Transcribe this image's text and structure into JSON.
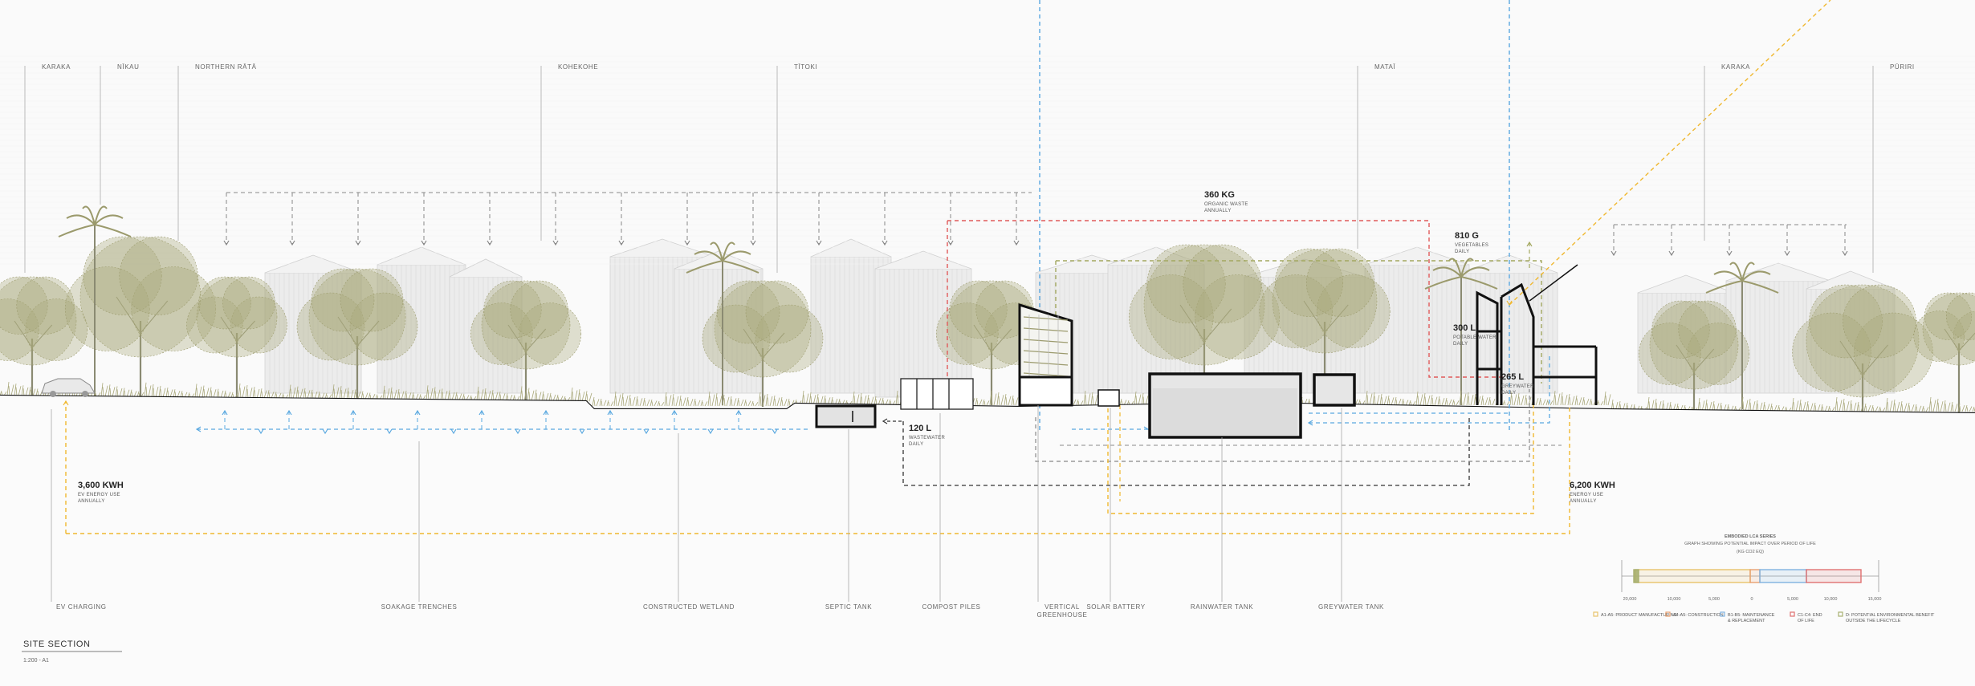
{
  "title": "SITE SECTION",
  "scale": "1:200 - A1",
  "species_labels": [
    "KARAKA",
    "NĪKAU",
    "NORTHERN RĀTĀ",
    "KOHEKOHE",
    "TĪTOKI",
    "MATAĪ",
    "KARAKA",
    "PŪRIRI"
  ],
  "component_labels": [
    "EV CHARGING",
    "SOAKAGE TRENCHES",
    "CONSTRUCTED WETLAND",
    "SEPTIC TANK",
    "COMPOST PILES",
    "VERTICAL GREENHOUSE",
    "SOLAR BATTERY",
    "RAINWATER TANK",
    "GREYWATER TANK"
  ],
  "quantities": [
    {
      "value": "360 KG",
      "sub1": "ORGANIC WASTE",
      "sub2": "ANNUALLY"
    },
    {
      "value": "810 G",
      "sub1": "VEGETABLES",
      "sub2": "DAILY"
    },
    {
      "value": "300 L",
      "sub1": "POTABLE WATER",
      "sub2": "DAILY"
    },
    {
      "value": "265 L",
      "sub1": "GREYWATER",
      "sub2": "DAILY"
    },
    {
      "value": "120 L",
      "sub1": "WASTEWATER",
      "sub2": "DAILY"
    },
    {
      "value": "3,600 KWH",
      "sub1": "EV ENERGY USE",
      "sub2": "ANNUALLY"
    },
    {
      "value": "6,200 KWH",
      "sub1": "ENERGY USE",
      "sub2": "ANNUALLY"
    }
  ],
  "embodied": {
    "title": "EMBODIED LCA SERIES",
    "subtitle": "GRAPH SHOWING POTENTIAL IMPACT OVER PERIOD OF LIFE",
    "unit": "(KG CO2 EQ)",
    "ticks": [
      "20,000",
      "10,000",
      "5,000",
      "0",
      "5,000",
      "10,000",
      "15,000"
    ],
    "legend": [
      {
        "label": "A1-A5: PRODUCT MANUFACTURING",
        "color": "#e8c36a"
      },
      {
        "label": "A4-A5: CONSTRUCTION",
        "color": "#e8a070"
      },
      {
        "label": "B1-B5: MAINTENANCE & REPLACEMENT",
        "color": "#7fb2e0"
      },
      {
        "label": "C1-C4: END OF LIFE",
        "color": "#e07070"
      },
      {
        "label": "D: POTENTIAL ENVIRONMENTAL BENEFIT OUTSIDE THE LIFECYCLE",
        "color": "#a8b070"
      }
    ]
  },
  "colors": {
    "blue": "#5aa8e0",
    "red": "#e05a5a",
    "yellow": "#f0b830",
    "green": "#a3a860",
    "grey": "#888888",
    "foliage": "#a9a87a"
  }
}
